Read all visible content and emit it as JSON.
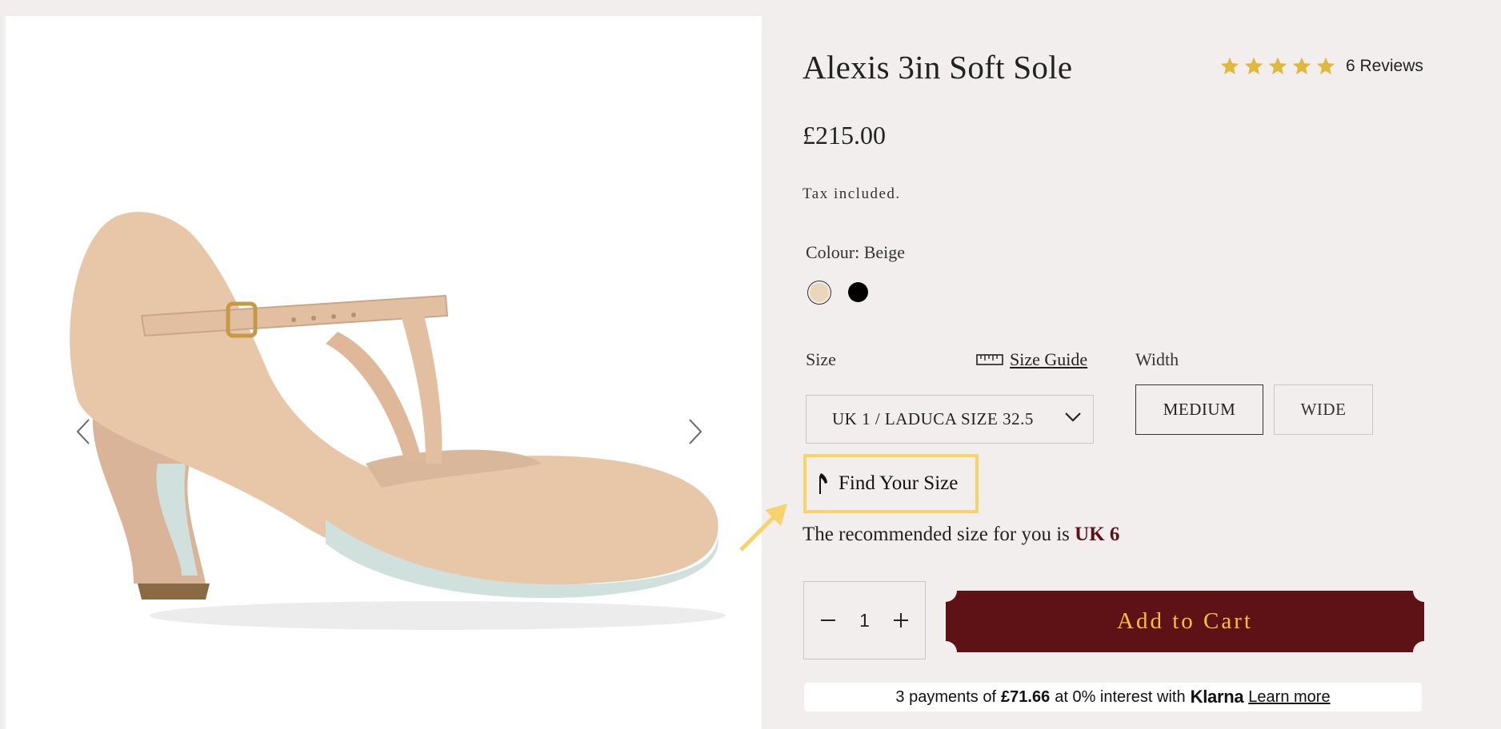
{
  "product": {
    "title": "Alexis 3in Soft Sole",
    "rating_stars": 5,
    "reviews_label": "6 Reviews",
    "price": "£215.00",
    "tax_note": "Tax included.",
    "image_alt": "beige leather t-bar dance shoe"
  },
  "colour": {
    "label": "Colour: Beige",
    "options": [
      "Beige",
      "Black"
    ],
    "selected": "Beige"
  },
  "size": {
    "label": "Size",
    "guide_label": "Size Guide",
    "selected": "UK 1 / LADUCA SIZE 32.5"
  },
  "width": {
    "label": "Width",
    "options": [
      "MEDIUM",
      "WIDE"
    ],
    "selected": "MEDIUM"
  },
  "find_size": {
    "label": "Find Your Size",
    "recommend_prefix": "The recommended size for you is",
    "recommend_value": "UK 6"
  },
  "quantity": {
    "value": "1"
  },
  "cart": {
    "label": "Add to Cart"
  },
  "klarna": {
    "prefix": "3 payments of",
    "amount": "£71.66",
    "middle": "at 0% interest with",
    "brand": "Klarna",
    "link": "Learn more"
  },
  "colors": {
    "background": "#f1eeed",
    "accent_dark_red": "#5e1215",
    "cart_text": "#f4c33a",
    "star": "#e0b93c",
    "highlight_box": "#f7d36a"
  }
}
